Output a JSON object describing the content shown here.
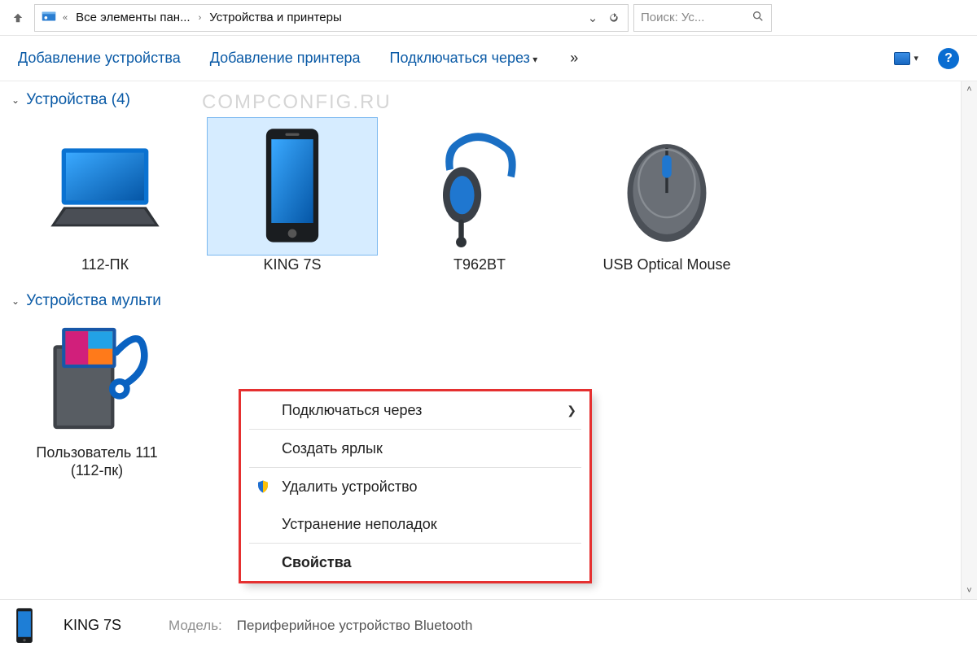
{
  "address_bar": {
    "crumb1": "Все элементы пан...",
    "crumb2": "Устройства и принтеры"
  },
  "search": {
    "placeholder": "Поиск: Ус..."
  },
  "command_bar": {
    "add_device": "Добавление устройства",
    "add_printer": "Добавление принтера",
    "connect_via": "Подключаться через",
    "overflow": "»"
  },
  "watermark": "COMPCONFIG.RU",
  "groups": {
    "devices": {
      "title": "Устройства (4)",
      "items": [
        {
          "label": "112-ПК"
        },
        {
          "label": "KING 7S"
        },
        {
          "label": "T962BT"
        },
        {
          "label": "USB Optical Mouse"
        }
      ]
    },
    "multimedia": {
      "title": "Устройства мульти",
      "items": [
        {
          "label": "Пользователь 111 (112-пк)"
        }
      ]
    }
  },
  "context_menu": {
    "connect_via": "Подключаться через",
    "create_shortcut": "Создать ярлык",
    "remove_device": "Удалить устройство",
    "troubleshoot": "Устранение неполадок",
    "properties": "Свойства"
  },
  "details": {
    "name": "KING 7S",
    "model_label": "Модель:",
    "model_value": "Периферийное устройство Bluetooth"
  }
}
